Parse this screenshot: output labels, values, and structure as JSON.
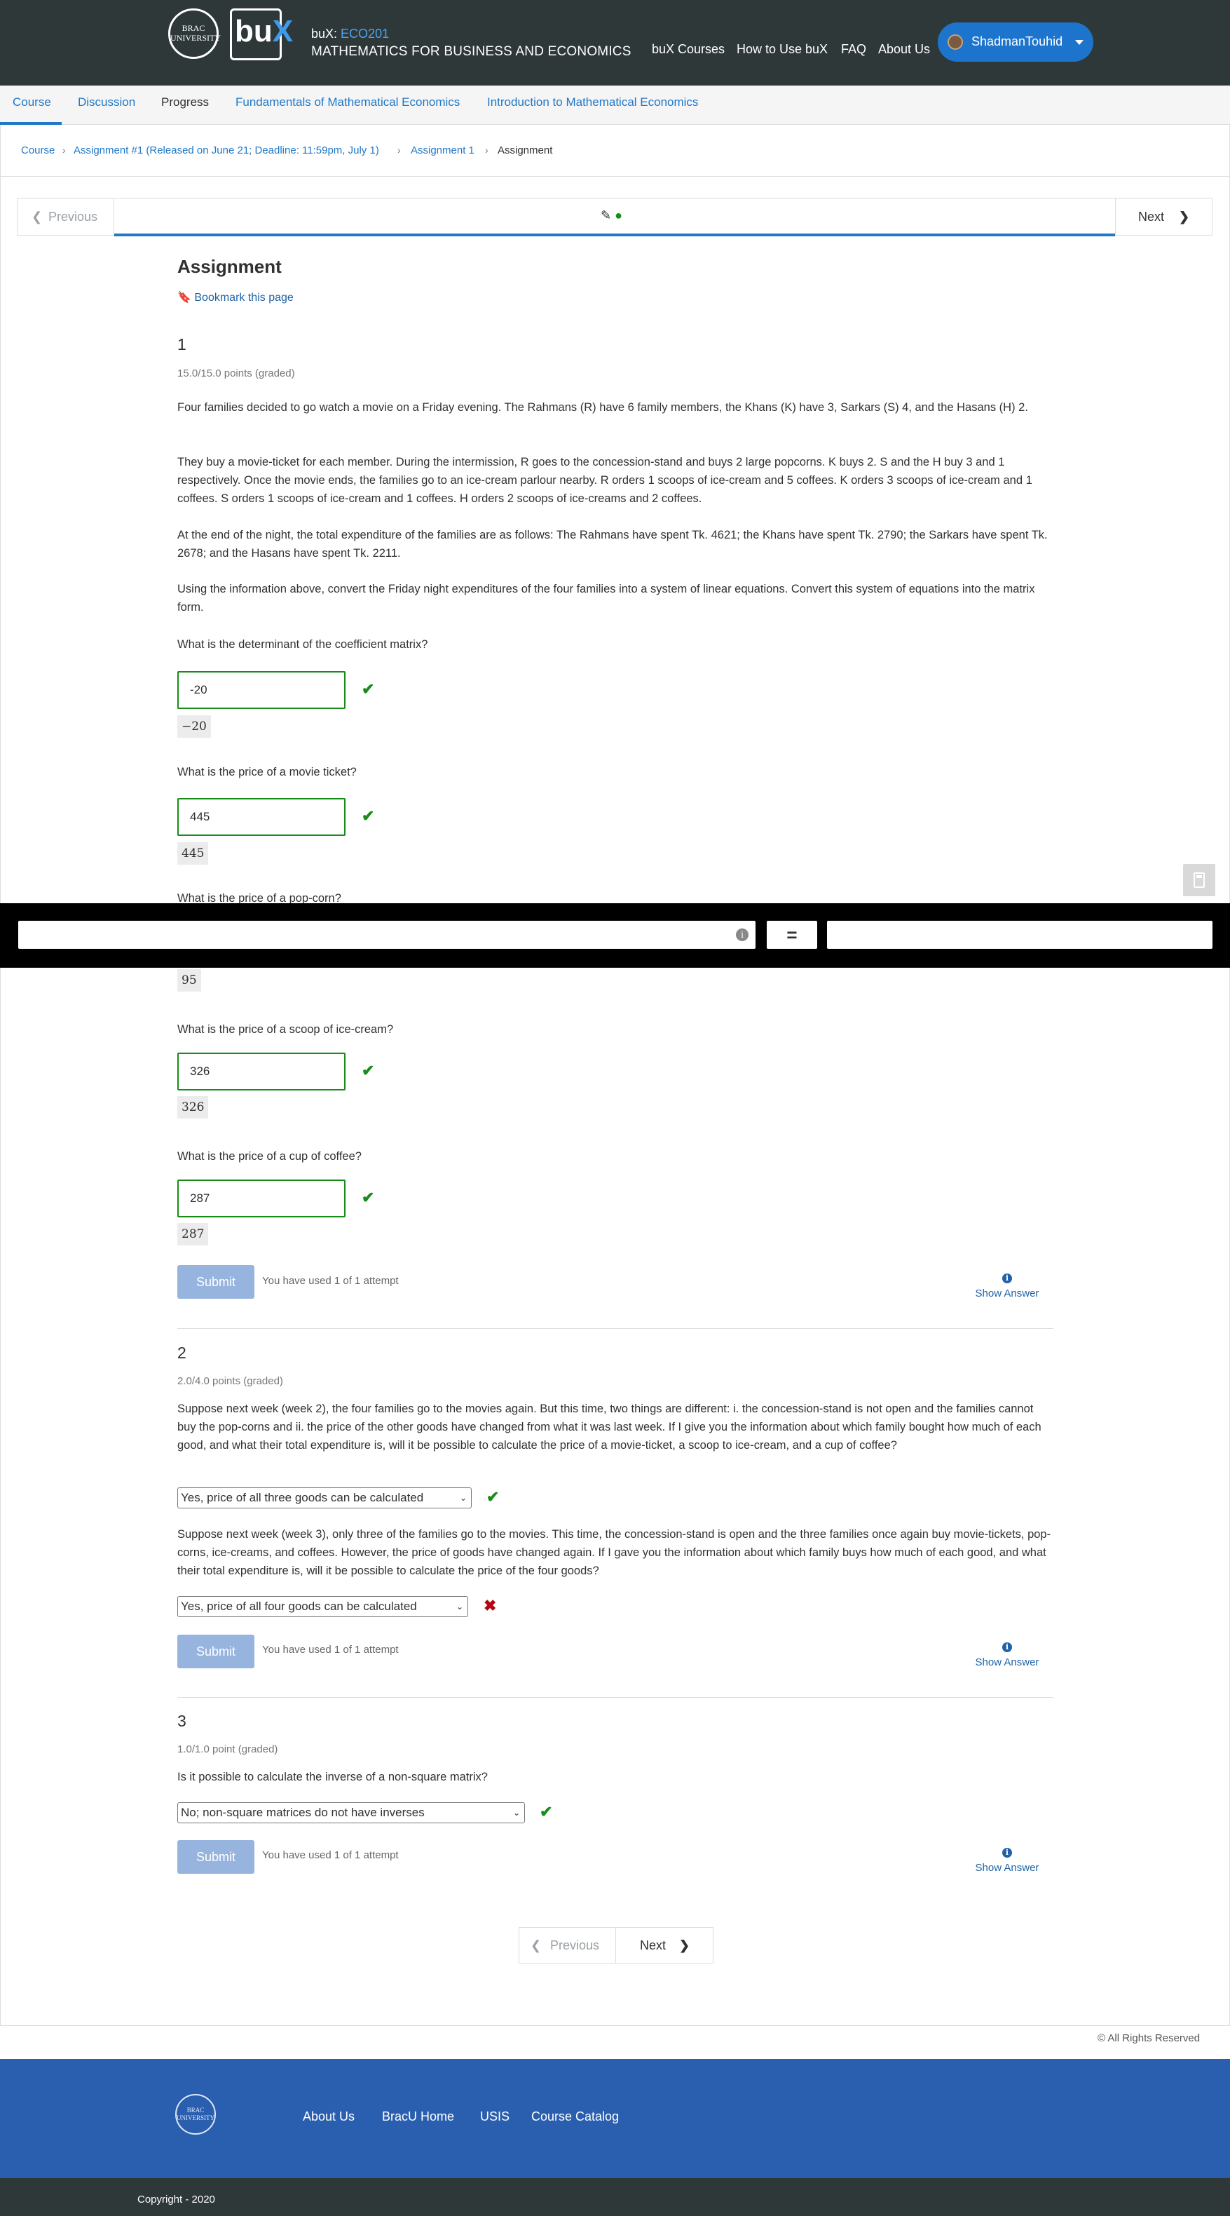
{
  "header": {
    "logo_left_text": "BRAC UNIVERSITY",
    "logo_bux": "buX",
    "course_prefix": "buX:",
    "course_code": "ECO201",
    "course_name": "MATHEMATICS FOR BUSINESS AND ECONOMICS",
    "nav": [
      "buX Courses",
      "How to Use buX",
      "FAQ",
      "About Us"
    ],
    "username": "ShadmanTouhid"
  },
  "tabs": [
    "Course",
    "Discussion",
    "Progress",
    "Fundamentals of Mathematical Economics",
    "Introduction to Mathematical Economics"
  ],
  "breadcrumb": [
    "Course",
    "Assignment #1 (Released on June 21; Deadline: 11:59pm, July 1)",
    "Assignment 1",
    "Assignment"
  ],
  "sequence": {
    "prev": "Previous",
    "next": "Next"
  },
  "page": {
    "title": "Assignment",
    "bookmark": "Bookmark this page"
  },
  "problem1": {
    "number": "1",
    "points": "15.0/15.0 points (graded)",
    "para1": "Four families decided to go watch a movie on a Friday evening. The Rahmans (R) have 6 family members, the Khans (K) have 3, Sarkars (S) 4, and the Hasans (H) 2.",
    "para2": "They buy a movie-ticket for each member. During the intermission, R goes to the concession-stand and buys 2 large popcorns. K buys 2. S and the H buy 3 and 1 respectively. Once the movie ends, the families go to an ice-cream parlour nearby. R orders 1 scoops of ice-cream and 5 coffees. K orders 3 scoops of ice-cream and 1 coffees. S orders 1 scoops of ice-cream and 1 coffees. H orders 2 scoops of ice-creams and 2 coffees.",
    "para3": "At the end of the night, the total expenditure of the families are as follows: The Rahmans have spent Tk. 4621; the Khans have spent Tk. 2790; the Sarkars have spent Tk. 2678; and the Hasans have spent Tk. 2211.",
    "para4": "Using the information above, convert the Friday night expenditures of the four families into a system of linear equations. Convert this system of equations into the matrix form.",
    "q1": "What is the determinant of the coefficient matrix?",
    "a1": "-20",
    "p1": "−20",
    "q2": "What is the price of a movie ticket?",
    "a2": "445",
    "p2": "445",
    "q3": "What is the price of a pop-corn?",
    "p3": "95",
    "q4": "What is the price of a scoop of ice-cream?",
    "a4": "326",
    "p4": "326",
    "q5": "What is the price of a cup of coffee?",
    "a5": "287",
    "p5": "287",
    "submit": "Submit",
    "attempts": "You have used 1 of 1 attempt",
    "show_answer": "Show Answer"
  },
  "problem2": {
    "number": "2",
    "points": "2.0/4.0 points (graded)",
    "para1": "Suppose next week (week 2), the four families go to the movies again. But this time, two things are different: i. the concession-stand is not open and the families cannot buy the pop-corns and ii. the price of the other goods have changed from what it was last week. If I give you the information about which family bought how much of each good, and what their total expenditure is, will it be possible to calculate the price of a movie-ticket, a scoop to ice-cream, and a cup of coffee?",
    "select1": "Yes, price of all three goods can be calculated",
    "para2": "Suppose next week (week 3), only three of the families go to the movies. This time, the concession-stand is open and the three families once again buy movie-tickets, pop-corns, ice-creams, and coffees. However, the price of goods have changed again. If I gave you the information about which family buys how much of each good, and what their total expenditure is, will it be possible to calculate the price of the four goods?",
    "select2": "Yes, price of all four goods can be calculated",
    "submit": "Submit",
    "attempts": "You have used 1 of 1 attempt",
    "show_answer": "Show Answer"
  },
  "problem3": {
    "number": "3",
    "points": "1.0/1.0 point (graded)",
    "question": "Is it possible to calculate the inverse of a non-square matrix?",
    "select": "No; non-square matrices do not have inverses",
    "submit": "Submit",
    "attempts": "You have used 1 of 1 attempt",
    "show_answer": "Show Answer"
  },
  "calculator": {
    "equals": "="
  },
  "bottom_nav": {
    "prev": "Previous",
    "next": "Next"
  },
  "rights": "© All Rights Reserved",
  "footer": {
    "logo_text": "BRAC UNIVERSITY",
    "links": [
      "About Us",
      "BracU Home",
      "USIS",
      "Course Catalog"
    ],
    "copyright": "Copyright - 2020"
  },
  "colors": {
    "header_bg": "#2f3839",
    "accent": "#1f78c8",
    "footer_bg": "#2a5faf",
    "correct": "#178c17",
    "incorrect": "#b20610",
    "submit_disabled": "#97b4df"
  }
}
